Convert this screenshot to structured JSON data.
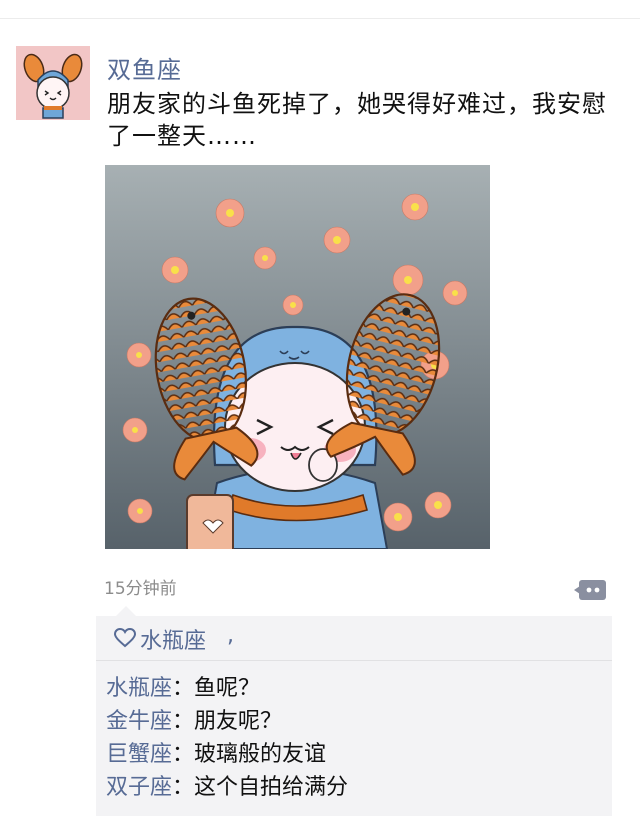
{
  "post": {
    "username": "双鱼座",
    "text": "朋友家的斗鱼死掉了，她哭得好难过，我安慰了一整天……",
    "timestamp": "15分钟前"
  },
  "likes": {
    "icon": "heart-outline-icon",
    "name": "水瓶座",
    "separator": ","
  },
  "comments": [
    {
      "name": "水瓶座",
      "sep": "：",
      "text": "鱼呢？"
    },
    {
      "name": "金牛座",
      "sep": "：",
      "text": "朋友呢？"
    },
    {
      "name": "巨蟹座",
      "sep": "：",
      "text": "玻璃般的友谊"
    },
    {
      "name": "双子座",
      "sep": "：",
      "text": "这个自拍给满分"
    }
  ],
  "colors": {
    "link": "#576b95",
    "text": "#111111",
    "meta": "#8c8c8c",
    "comment_bg": "#f3f3f5"
  }
}
